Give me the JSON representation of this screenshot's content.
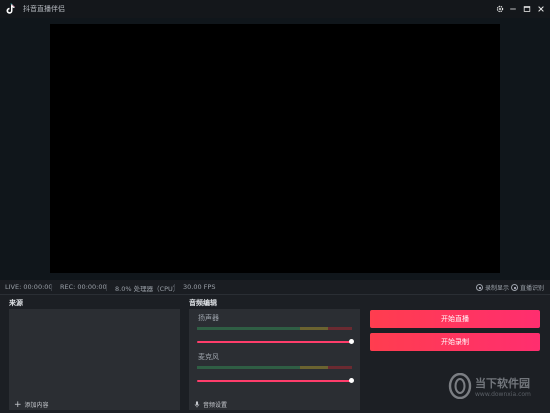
{
  "titlebar": {
    "title": "抖音直播伴侣",
    "icons": [
      "douyin-logo-icon",
      "settings-icon",
      "minimize-icon",
      "maximize-icon",
      "close-icon"
    ]
  },
  "status": {
    "live": "LIVE: 00:00:00",
    "rec": "REC: 00:00:00",
    "cpu": "8.0% 处理器（CPU）",
    "fps": "30.00 FPS",
    "radios": [
      "录制显示",
      "直播识别"
    ]
  },
  "sources": {
    "title": "来源",
    "add_label": "添加内容"
  },
  "audio": {
    "title": "音频编辑",
    "speaker_label": "扬声器",
    "mic_label": "麦克风",
    "mic_settings_label": "音频设置",
    "speaker_volume": 1.0,
    "mic_volume": 1.0
  },
  "actions": {
    "start_live": "开始直播",
    "start_record": "开始录制"
  },
  "watermark": {
    "line1": "当下软件园",
    "line2": "www.downxia.com"
  },
  "colors": {
    "accent": "#ff3d6b",
    "button_start": "#ff3d4f",
    "button_end": "#ff2e6f",
    "preview": "#000000"
  }
}
